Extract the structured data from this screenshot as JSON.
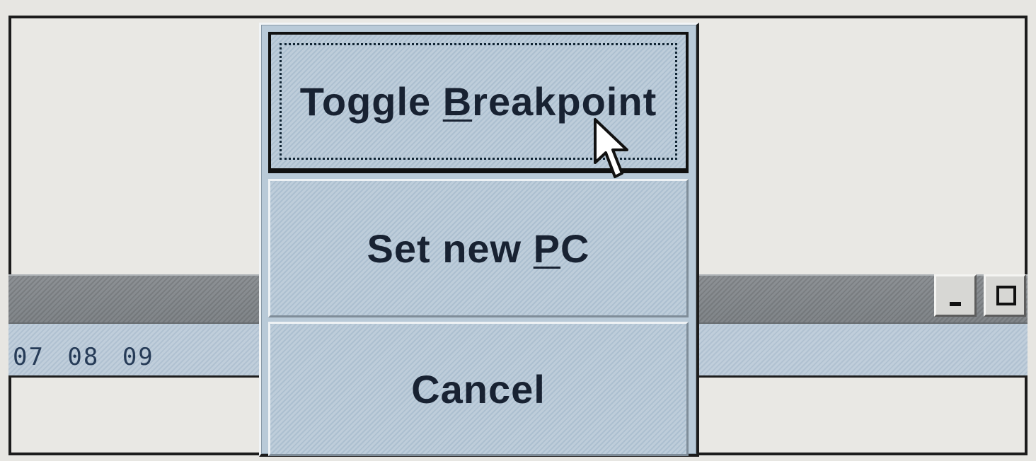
{
  "background": {
    "hex_row_text": "07 08 09"
  },
  "context_menu": {
    "items": [
      {
        "label_pre": "Toggle ",
        "accel": "B",
        "label_post": "reakpoint"
      },
      {
        "label_pre": "Set new ",
        "accel": "P",
        "label_post": "C"
      },
      {
        "label_pre": "Cancel",
        "accel": "",
        "label_post": ""
      }
    ]
  },
  "window_controls": {
    "minimize_icon": "minimize-icon",
    "restore_icon": "restore-icon"
  },
  "colors": {
    "menu_blue": "#b9cad8",
    "text_dark": "#182232",
    "titlebar_gray": "#8b8f93"
  }
}
